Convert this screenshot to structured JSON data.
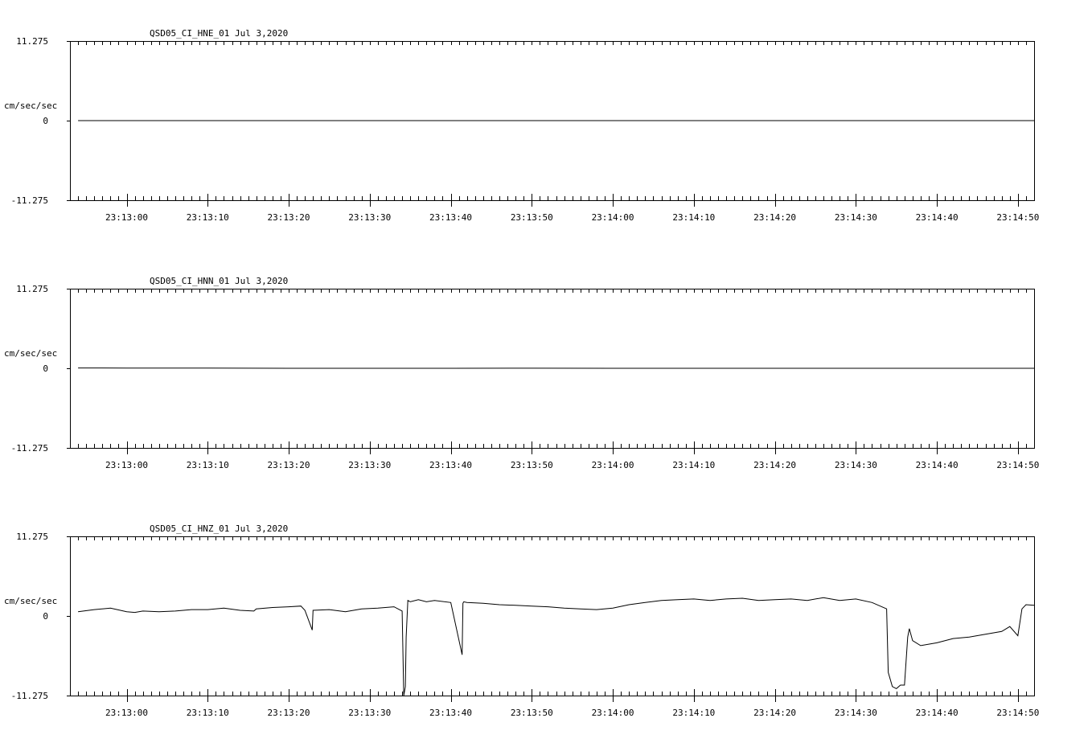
{
  "chart_data": [
    {
      "type": "line",
      "title": "QSD05_CI_HNE_01  Jul 3,2020",
      "ylabel": "cm/sec/sec",
      "yticks": [
        "11.275",
        "0",
        "-11.275"
      ],
      "ylim": [
        -11.275,
        11.275
      ],
      "xticks": [
        "23:13:00",
        "23:13:10",
        "23:13:20",
        "23:13:30",
        "23:13:40",
        "23:13:50",
        "23:14:00",
        "23:14:10",
        "23:14:20",
        "23:14:30",
        "23:14:40",
        "23:14:50"
      ],
      "xlim_seconds_after_2313": [
        -7,
        112
      ],
      "series": [
        {
          "x": [
            -6,
            112
          ],
          "y": [
            0,
            0
          ]
        }
      ]
    },
    {
      "type": "line",
      "title": "QSD05_CI_HNN_01  Jul 3,2020",
      "ylabel": "cm/sec/sec",
      "yticks": [
        "11.275",
        "0",
        "-11.275"
      ],
      "ylim": [
        -11.275,
        11.275
      ],
      "xticks": [
        "23:13:00",
        "23:13:10",
        "23:13:20",
        "23:13:30",
        "23:13:40",
        "23:13:50",
        "23:14:00",
        "23:14:10",
        "23:14:20",
        "23:14:30",
        "23:14:40",
        "23:14:50"
      ],
      "xlim_seconds_after_2313": [
        -7,
        112
      ],
      "series": [
        {
          "x": [
            -6,
            -3,
            0,
            10,
            20,
            30,
            40,
            50,
            60,
            70,
            80,
            90,
            100,
            112
          ],
          "y": [
            0.05,
            0.05,
            0.03,
            0.02,
            0.0,
            0.0,
            0.0,
            0.01,
            0.0,
            0.0,
            0.0,
            0.0,
            0.0,
            0.0
          ]
        }
      ]
    },
    {
      "type": "line",
      "title": "QSD05_CI_HNZ_01  Jul 3,2020",
      "ylabel": "cm/sec/sec",
      "yticks": [
        "11.275",
        "0",
        "-11.275"
      ],
      "ylim": [
        -11.275,
        11.275
      ],
      "xticks": [
        "23:13:00",
        "23:13:10",
        "23:13:20",
        "23:13:30",
        "23:13:40",
        "23:13:50",
        "23:14:00",
        "23:14:10",
        "23:14:20",
        "23:14:30",
        "23:14:40",
        "23:14:50"
      ],
      "xlim_seconds_after_2313": [
        -7,
        112
      ],
      "series": [
        {
          "x": [
            -6,
            -4,
            -2,
            0,
            1,
            2,
            4,
            6,
            8,
            10,
            12,
            14,
            15.7,
            16,
            18,
            20,
            21.5,
            22,
            22.9,
            23,
            25,
            27,
            29,
            31,
            33,
            34.0,
            34.2,
            34.4,
            34.5,
            34.7,
            35,
            36,
            37,
            38,
            40,
            41.4,
            41.5,
            41.6,
            42,
            44,
            46,
            48,
            50,
            52,
            54,
            56,
            58,
            60,
            62,
            64,
            66,
            68,
            70,
            72,
            74,
            76,
            78,
            80,
            82,
            84,
            86,
            88,
            90,
            92,
            93.8,
            94.0,
            94.5,
            95,
            95.5,
            96,
            96.4,
            96.6,
            97,
            98,
            100,
            102,
            104,
            106,
            108,
            109,
            110,
            110.5,
            111,
            112
          ],
          "y": [
            0.6,
            0.9,
            1.1,
            0.6,
            0.5,
            0.7,
            0.6,
            0.7,
            0.9,
            0.9,
            1.1,
            0.8,
            0.7,
            1.0,
            1.2,
            1.3,
            1.4,
            0.8,
            -2.0,
            0.8,
            0.9,
            0.6,
            1.0,
            1.1,
            1.3,
            0.7,
            -11.3,
            -10.0,
            -3.0,
            2.2,
            2.0,
            2.3,
            2.0,
            2.2,
            1.9,
            -5.5,
            1.8,
            2.0,
            1.9,
            1.8,
            1.6,
            1.5,
            1.4,
            1.3,
            1.1,
            1.0,
            0.9,
            1.1,
            1.6,
            1.9,
            2.2,
            2.3,
            2.4,
            2.2,
            2.4,
            2.5,
            2.2,
            2.3,
            2.4,
            2.2,
            2.6,
            2.2,
            2.4,
            1.9,
            1.0,
            -8.0,
            -10.0,
            -10.3,
            -9.8,
            -9.8,
            -3.0,
            -1.8,
            -3.5,
            -4.2,
            -3.8,
            -3.2,
            -3.0,
            -2.6,
            -2.2,
            -1.5,
            -2.8,
            1.0,
            1.6,
            1.5
          ]
        }
      ]
    }
  ]
}
